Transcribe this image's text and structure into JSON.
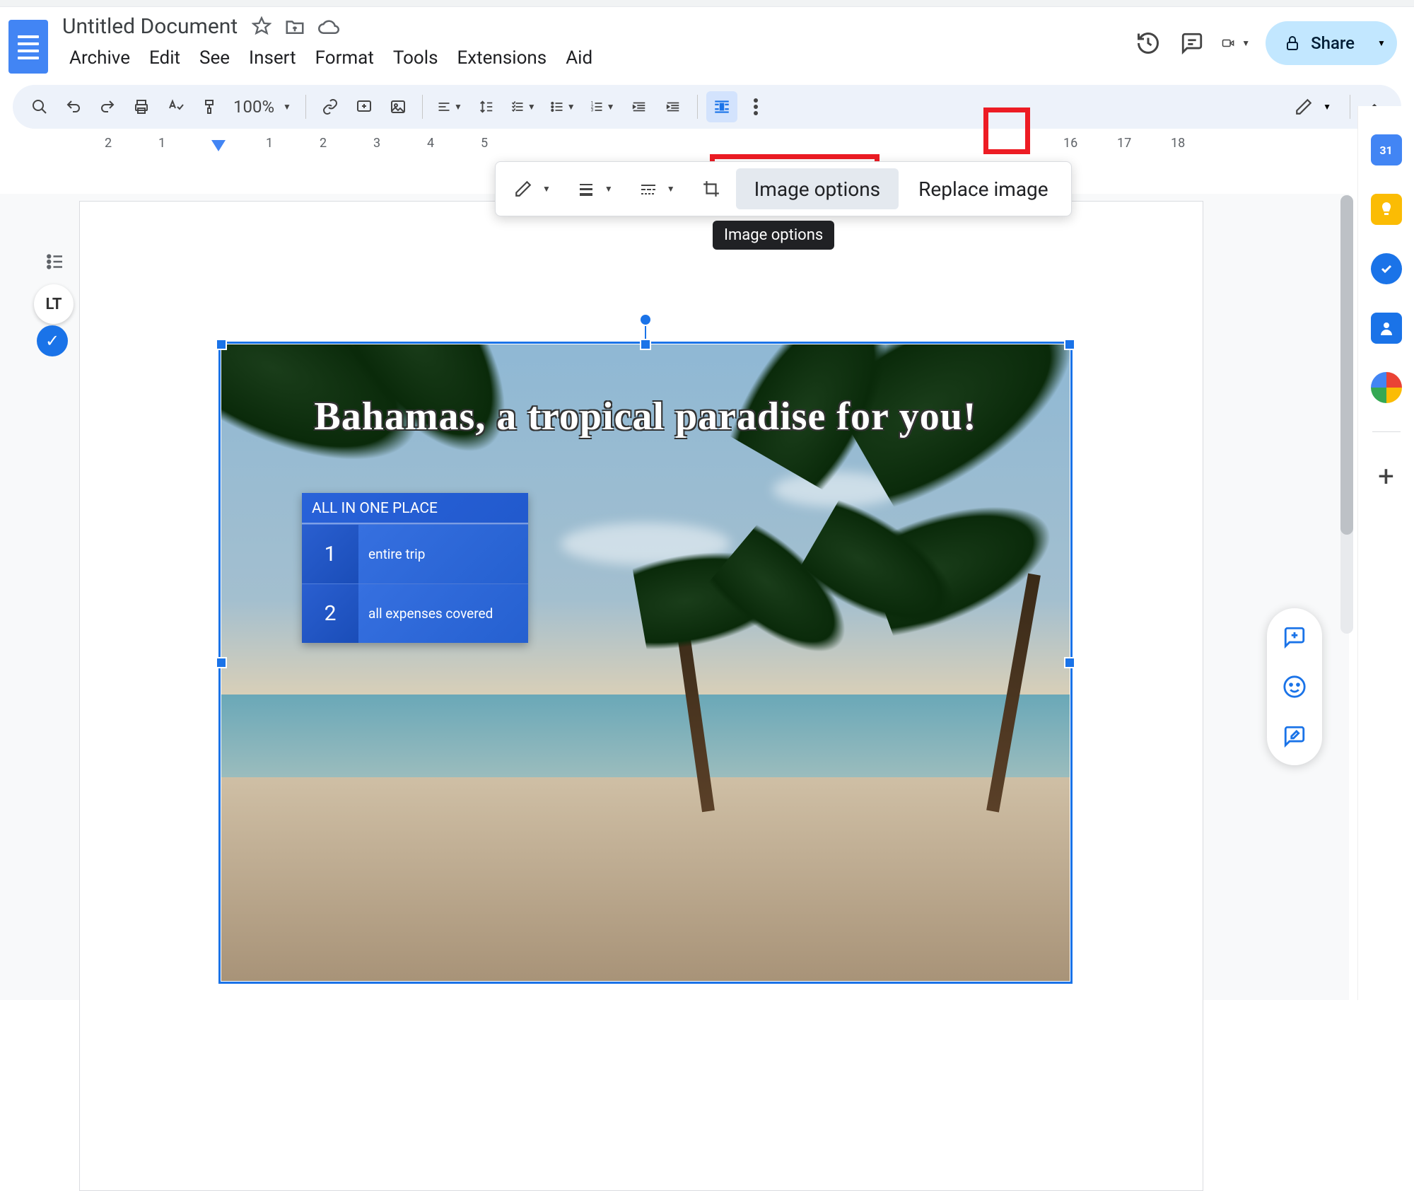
{
  "doc": {
    "name": "Untitled Document"
  },
  "menus": [
    "Archive",
    "Edit",
    "See",
    "Insert",
    "Format",
    "Tools",
    "Extensions",
    "Aid"
  ],
  "header": {
    "share_label": "Share"
  },
  "toolbar": {
    "zoom": "100%"
  },
  "image_toolbar": {
    "image_options": "Image options",
    "replace_image": "Replace image",
    "tooltip": "Image options"
  },
  "ruler": {
    "marks": [
      "2",
      "1",
      "",
      "1",
      "2",
      "3",
      "4",
      "5",
      "",
      "",
      "",
      "",
      "",
      "",
      "",
      "",
      "",
      "",
      "",
      "16",
      "17",
      "18"
    ]
  },
  "doc_image": {
    "headline": "Bahamas, a tropical paradise for you!",
    "box_title": "ALL IN ONE PLACE",
    "rows": [
      {
        "num": "1",
        "text": "entire trip"
      },
      {
        "num": "2",
        "text": "all expenses covered"
      }
    ]
  },
  "side_panel": {
    "calendar_day": "31"
  }
}
